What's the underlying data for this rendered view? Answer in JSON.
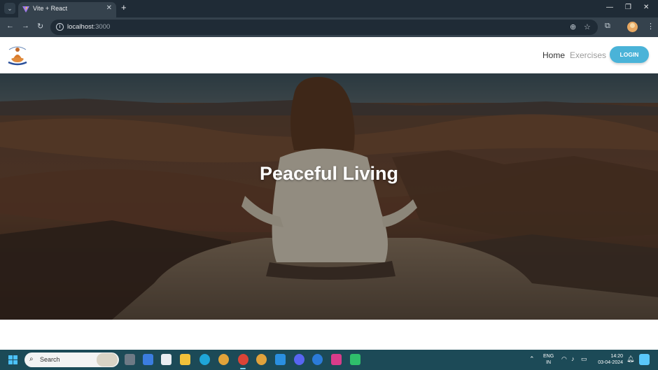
{
  "browser": {
    "tab_title": "Vite + React",
    "url_host": "localhost",
    "url_port": ":3000"
  },
  "site": {
    "nav_home": "Home",
    "nav_exercises": "Exercises",
    "login_label": "LOGIN",
    "hero_title": "Peaceful Living",
    "accent_color": "#4ab3d8"
  },
  "taskbar": {
    "search_placeholder": "Search",
    "lang_line1": "ENG",
    "lang_line2": "IN",
    "time": "14:20",
    "date": "03-04-2024",
    "color": "#1c4a57"
  }
}
